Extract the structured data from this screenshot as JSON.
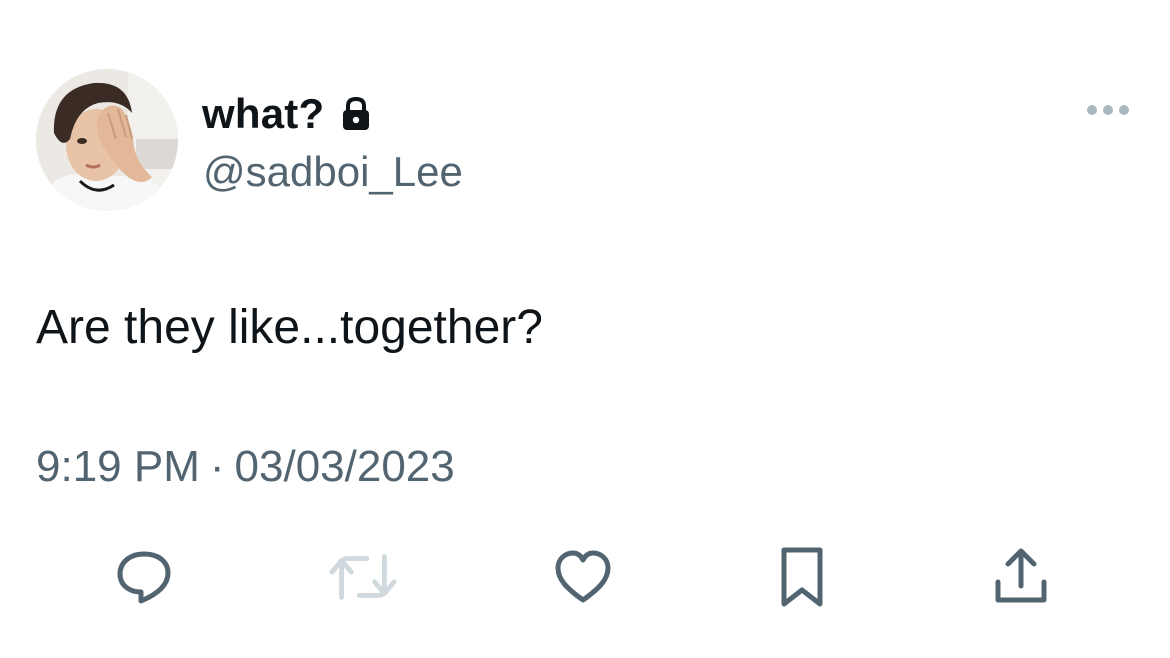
{
  "author": {
    "display_name": "what?",
    "handle": "@sadboi_Lee",
    "protected_icon": "lock-icon",
    "avatar": "profile-photo"
  },
  "more_menu_icon": "more-horizontal-icon",
  "tweet": {
    "text": "Are they like...together?",
    "time": "9:19 PM",
    "separator": "·",
    "date": "03/03/2023"
  },
  "actions": [
    {
      "name": "reply",
      "icon": "reply-icon",
      "color": "#536471",
      "disabled": false
    },
    {
      "name": "retweet",
      "icon": "retweet-icon",
      "color": "#cfd9de",
      "disabled": true
    },
    {
      "name": "like",
      "icon": "heart-icon",
      "color": "#536471",
      "disabled": false
    },
    {
      "name": "bookmark",
      "icon": "bookmark-icon",
      "color": "#536471",
      "disabled": false
    },
    {
      "name": "share",
      "icon": "share-icon",
      "color": "#536471",
      "disabled": false
    }
  ],
  "colors": {
    "text_primary": "#0f1419",
    "text_secondary": "#536471",
    "disabled_icon": "#cfd9de",
    "menu_dots": "#aab8c2"
  }
}
